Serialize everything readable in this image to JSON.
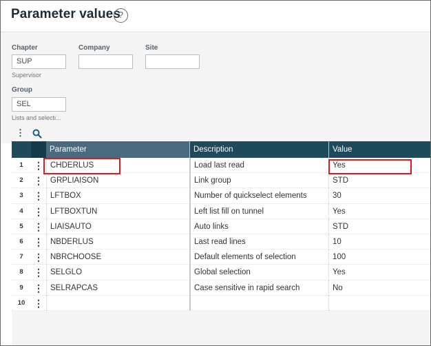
{
  "header": {
    "title": "Parameter values",
    "help_glyph": "?"
  },
  "fields": {
    "chapter": {
      "label": "Chapter",
      "value": "SUP",
      "hint": "Supervisor"
    },
    "company": {
      "label": "Company",
      "value": ""
    },
    "site": {
      "label": "Site",
      "value": ""
    },
    "group": {
      "label": "Group",
      "value": "SEL",
      "hint": "Lists and selecti..."
    }
  },
  "toolbar": {
    "menu_glyph": "⋮",
    "icons": [
      "menu-dots-icon",
      "search-icon"
    ]
  },
  "grid": {
    "columns": [
      "Parameter",
      "Description",
      "Value"
    ],
    "rows": [
      {
        "num": "1",
        "param": "CHDERLUS",
        "desc": "Load last read",
        "value": "Yes"
      },
      {
        "num": "2",
        "param": "GRPLIAISON",
        "desc": "Link group",
        "value": "STD"
      },
      {
        "num": "3",
        "param": "LFTBOX",
        "desc": "Number of quickselect elements",
        "value": "30"
      },
      {
        "num": "4",
        "param": "LFTBOXTUN",
        "desc": "Left list fill on tunnel",
        "value": "Yes"
      },
      {
        "num": "5",
        "param": "LIAISAUTO",
        "desc": "Auto links",
        "value": "STD"
      },
      {
        "num": "6",
        "param": "NBDERLUS",
        "desc": "Last read lines",
        "value": "10"
      },
      {
        "num": "7",
        "param": "NBRCHOOSE",
        "desc": "Default elements of selection",
        "value": "100"
      },
      {
        "num": "8",
        "param": "SELGLO",
        "desc": "Global selection",
        "value": "Yes"
      },
      {
        "num": "9",
        "param": "SELRAPCAS",
        "desc": "Case sensitive in rapid search",
        "value": "No"
      },
      {
        "num": "10",
        "param": "",
        "desc": "",
        "value": ""
      }
    ],
    "row_menu_glyph": "⋮"
  },
  "colors": {
    "header_bg": "#1f4a5c",
    "highlight": "#e4181c",
    "panel_bg": "#f4f4f4"
  }
}
